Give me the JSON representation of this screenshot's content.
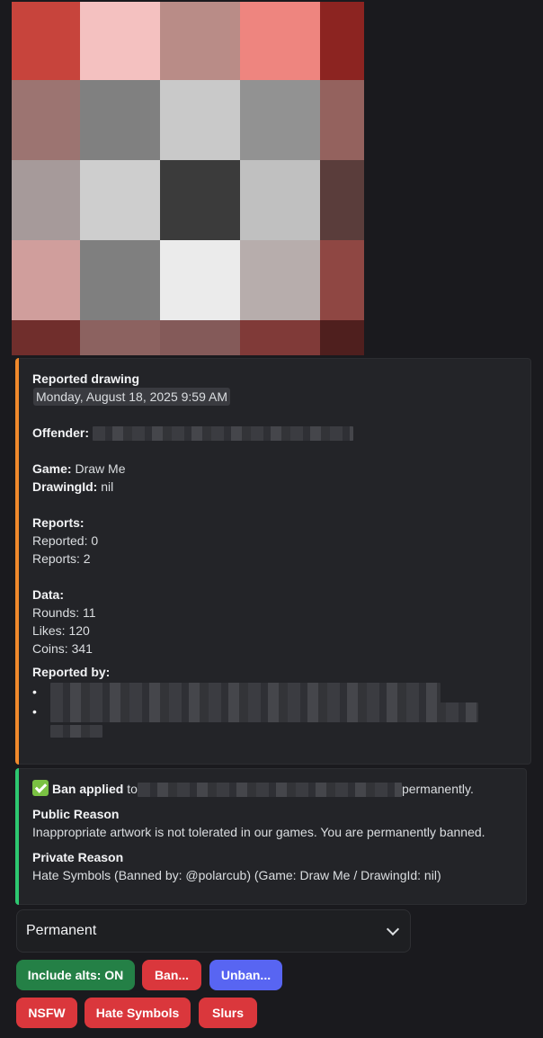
{
  "report": {
    "title": "Reported drawing",
    "timestamp": "Monday, August 18, 2025 9:59 AM",
    "offender_label": "Offender:",
    "game_label": "Game:",
    "game_value": " Draw Me",
    "drawing_label": "DrawingId:",
    "drawing_value": " nil",
    "reports_label": "Reports:",
    "reported_line": "Reported: 0",
    "reports_line": "Reports: 2",
    "data_label": "Data:",
    "rounds_line": "Rounds: 11",
    "likes_line": "Likes: 120",
    "coins_line": "Coins: 341",
    "reported_by_label": "Reported by:",
    "bullet": "•"
  },
  "ban": {
    "icon": "white-check-mark-icon",
    "applied_label": "Ban applied",
    "to_text": " to",
    "permanently_text": "permanently.",
    "public_title": "Public Reason",
    "public_text": "Inappropriate artwork is not tolerated in our games. You are permanently banned.",
    "private_title": "Private Reason",
    "private_text": "Hate Symbols (Banned by: @polarcub) (Game: Draw Me / DrawingId: nil)"
  },
  "duration_select": {
    "value": "Permanent"
  },
  "buttons": {
    "include_alts": "Include alts: ON",
    "ban": "Ban...",
    "unban": "Unban...",
    "nsfw": "NSFW",
    "hate_symbols": "Hate Symbols",
    "slurs": "Slurs"
  },
  "colors": {
    "report_accent": "#f0892c",
    "ban_accent": "#2dc770",
    "green_button": "#248046",
    "red_button": "#da373c",
    "blurple_button": "#5865f2"
  },
  "pixel_art": {
    "cells": [
      "#c7443c",
      "#f4c1c0",
      "#b98c87",
      "#ee857f",
      "#8c2421",
      "#9c7471",
      "#808080",
      "#c9c9c9",
      "#929292",
      "#94625e",
      "#a69a9a",
      "#cecece",
      "#3b3b3b",
      "#c0c0c0",
      "#5a3d3b",
      "#d09e9c",
      "#7f7f7f",
      "#ebebeb",
      "#b7adac",
      "#8f4743",
      "#702e2c",
      "#8c6260",
      "#845a59",
      "#803a38",
      "#4f1f1e"
    ]
  }
}
